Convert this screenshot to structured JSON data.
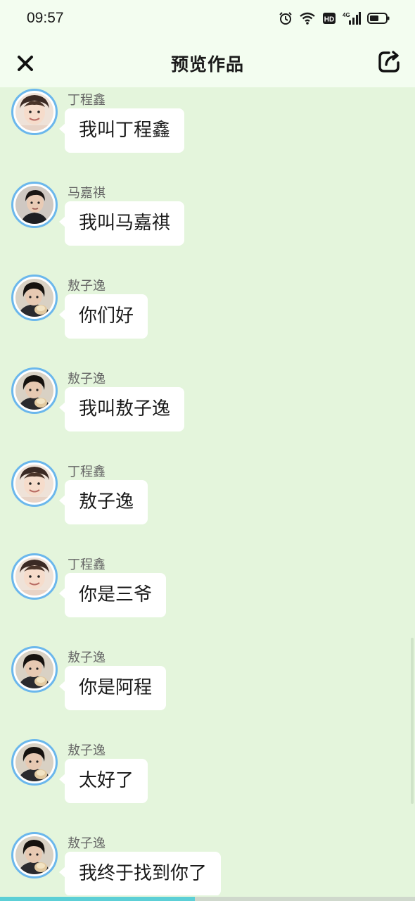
{
  "status_bar": {
    "time": "09:57",
    "icons": [
      "alarm-icon",
      "wifi-icon",
      "hd-icon",
      "signal-4g-icon",
      "battery-icon"
    ],
    "hd_label": "HD",
    "network_label": "4G"
  },
  "header": {
    "title": "预览作品",
    "close_icon": "close-icon",
    "share_icon": "share-icon"
  },
  "messages": [
    {
      "sender": "丁程鑫",
      "text": "我叫丁程鑫",
      "avatar": "avatar-ding"
    },
    {
      "sender": "马嘉祺",
      "text": "我叫马嘉祺",
      "avatar": "avatar-ma"
    },
    {
      "sender": "敖子逸",
      "text": "你们好",
      "avatar": "avatar-ao"
    },
    {
      "sender": "敖子逸",
      "text": "我叫敖子逸",
      "avatar": "avatar-ao"
    },
    {
      "sender": "丁程鑫",
      "text": "敖子逸",
      "avatar": "avatar-ding"
    },
    {
      "sender": "丁程鑫",
      "text": "你是三爷",
      "avatar": "avatar-ding"
    },
    {
      "sender": "敖子逸",
      "text": "你是阿程",
      "avatar": "avatar-ao"
    },
    {
      "sender": "敖子逸",
      "text": "太好了",
      "avatar": "avatar-ao"
    },
    {
      "sender": "敖子逸",
      "text": "我终于找到你了",
      "avatar": "avatar-ao"
    }
  ],
  "colors": {
    "background": "#e4f5dc",
    "header": "#f3fdf0",
    "avatar_ring": "#6bb7ec",
    "bubble": "#ffffff",
    "progress": "#5ccfd6"
  },
  "playback_progress": 0.47
}
